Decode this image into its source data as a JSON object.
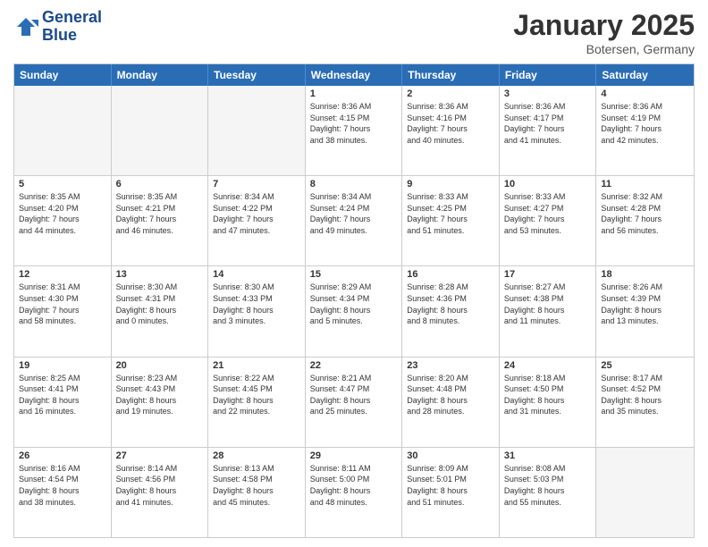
{
  "header": {
    "logo_line1": "General",
    "logo_line2": "Blue",
    "month": "January 2025",
    "location": "Botersen, Germany"
  },
  "day_names": [
    "Sunday",
    "Monday",
    "Tuesday",
    "Wednesday",
    "Thursday",
    "Friday",
    "Saturday"
  ],
  "weeks": [
    [
      {
        "day": "",
        "info": ""
      },
      {
        "day": "",
        "info": ""
      },
      {
        "day": "",
        "info": ""
      },
      {
        "day": "1",
        "info": "Sunrise: 8:36 AM\nSunset: 4:15 PM\nDaylight: 7 hours\nand 38 minutes."
      },
      {
        "day": "2",
        "info": "Sunrise: 8:36 AM\nSunset: 4:16 PM\nDaylight: 7 hours\nand 40 minutes."
      },
      {
        "day": "3",
        "info": "Sunrise: 8:36 AM\nSunset: 4:17 PM\nDaylight: 7 hours\nand 41 minutes."
      },
      {
        "day": "4",
        "info": "Sunrise: 8:36 AM\nSunset: 4:19 PM\nDaylight: 7 hours\nand 42 minutes."
      }
    ],
    [
      {
        "day": "5",
        "info": "Sunrise: 8:35 AM\nSunset: 4:20 PM\nDaylight: 7 hours\nand 44 minutes."
      },
      {
        "day": "6",
        "info": "Sunrise: 8:35 AM\nSunset: 4:21 PM\nDaylight: 7 hours\nand 46 minutes."
      },
      {
        "day": "7",
        "info": "Sunrise: 8:34 AM\nSunset: 4:22 PM\nDaylight: 7 hours\nand 47 minutes."
      },
      {
        "day": "8",
        "info": "Sunrise: 8:34 AM\nSunset: 4:24 PM\nDaylight: 7 hours\nand 49 minutes."
      },
      {
        "day": "9",
        "info": "Sunrise: 8:33 AM\nSunset: 4:25 PM\nDaylight: 7 hours\nand 51 minutes."
      },
      {
        "day": "10",
        "info": "Sunrise: 8:33 AM\nSunset: 4:27 PM\nDaylight: 7 hours\nand 53 minutes."
      },
      {
        "day": "11",
        "info": "Sunrise: 8:32 AM\nSunset: 4:28 PM\nDaylight: 7 hours\nand 56 minutes."
      }
    ],
    [
      {
        "day": "12",
        "info": "Sunrise: 8:31 AM\nSunset: 4:30 PM\nDaylight: 7 hours\nand 58 minutes."
      },
      {
        "day": "13",
        "info": "Sunrise: 8:30 AM\nSunset: 4:31 PM\nDaylight: 8 hours\nand 0 minutes."
      },
      {
        "day": "14",
        "info": "Sunrise: 8:30 AM\nSunset: 4:33 PM\nDaylight: 8 hours\nand 3 minutes."
      },
      {
        "day": "15",
        "info": "Sunrise: 8:29 AM\nSunset: 4:34 PM\nDaylight: 8 hours\nand 5 minutes."
      },
      {
        "day": "16",
        "info": "Sunrise: 8:28 AM\nSunset: 4:36 PM\nDaylight: 8 hours\nand 8 minutes."
      },
      {
        "day": "17",
        "info": "Sunrise: 8:27 AM\nSunset: 4:38 PM\nDaylight: 8 hours\nand 11 minutes."
      },
      {
        "day": "18",
        "info": "Sunrise: 8:26 AM\nSunset: 4:39 PM\nDaylight: 8 hours\nand 13 minutes."
      }
    ],
    [
      {
        "day": "19",
        "info": "Sunrise: 8:25 AM\nSunset: 4:41 PM\nDaylight: 8 hours\nand 16 minutes."
      },
      {
        "day": "20",
        "info": "Sunrise: 8:23 AM\nSunset: 4:43 PM\nDaylight: 8 hours\nand 19 minutes."
      },
      {
        "day": "21",
        "info": "Sunrise: 8:22 AM\nSunset: 4:45 PM\nDaylight: 8 hours\nand 22 minutes."
      },
      {
        "day": "22",
        "info": "Sunrise: 8:21 AM\nSunset: 4:47 PM\nDaylight: 8 hours\nand 25 minutes."
      },
      {
        "day": "23",
        "info": "Sunrise: 8:20 AM\nSunset: 4:48 PM\nDaylight: 8 hours\nand 28 minutes."
      },
      {
        "day": "24",
        "info": "Sunrise: 8:18 AM\nSunset: 4:50 PM\nDaylight: 8 hours\nand 31 minutes."
      },
      {
        "day": "25",
        "info": "Sunrise: 8:17 AM\nSunset: 4:52 PM\nDaylight: 8 hours\nand 35 minutes."
      }
    ],
    [
      {
        "day": "26",
        "info": "Sunrise: 8:16 AM\nSunset: 4:54 PM\nDaylight: 8 hours\nand 38 minutes."
      },
      {
        "day": "27",
        "info": "Sunrise: 8:14 AM\nSunset: 4:56 PM\nDaylight: 8 hours\nand 41 minutes."
      },
      {
        "day": "28",
        "info": "Sunrise: 8:13 AM\nSunset: 4:58 PM\nDaylight: 8 hours\nand 45 minutes."
      },
      {
        "day": "29",
        "info": "Sunrise: 8:11 AM\nSunset: 5:00 PM\nDaylight: 8 hours\nand 48 minutes."
      },
      {
        "day": "30",
        "info": "Sunrise: 8:09 AM\nSunset: 5:01 PM\nDaylight: 8 hours\nand 51 minutes."
      },
      {
        "day": "31",
        "info": "Sunrise: 8:08 AM\nSunset: 5:03 PM\nDaylight: 8 hours\nand 55 minutes."
      },
      {
        "day": "",
        "info": ""
      }
    ]
  ]
}
